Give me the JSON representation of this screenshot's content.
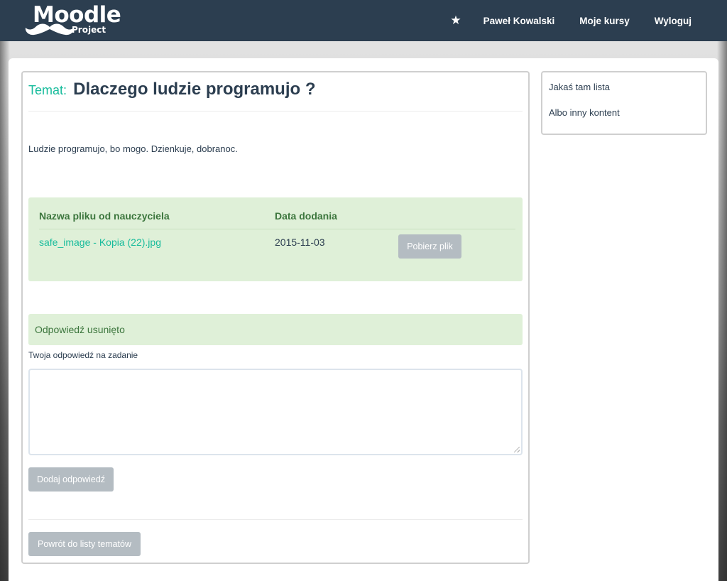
{
  "header": {
    "logo": {
      "title": "Moodle",
      "subtitle": "Project"
    },
    "nav": {
      "star_icon": "star-icon",
      "user_name": "Paweł Kowalski",
      "my_courses": "Moje kursy",
      "logout": "Wyloguj"
    }
  },
  "main": {
    "topic_label": "Temat:",
    "topic_title": "Dlaczego ludzie programujo ?",
    "description": "Ludzie programujo, bo mogo. Dzienkuje, dobranoc.",
    "files": {
      "columns": [
        "Nazwa pliku od nauczyciela",
        "Data dodania"
      ],
      "rows": [
        {
          "file_name": "safe_image - Kopia (22).jpg",
          "date": "2015-11-03",
          "download_label": "Pobierz plik"
        }
      ]
    },
    "alert_text": "Odpowiedź usunięto",
    "answer_label": "Twoja odpowiedź na zadanie",
    "answer_value": "",
    "add_answer_label": "Dodaj odpowiedź",
    "back_label": "Powrót do listy tematów"
  },
  "sidebar": {
    "items": [
      "Jakaś tam lista",
      "Albo inny kontent"
    ]
  },
  "colors": {
    "navbar": "#2c3e50",
    "accent": "#18bc9c",
    "success_bg": "#dff0d8",
    "success_text": "#3c763d",
    "button_grey": "#b4bcc2"
  }
}
